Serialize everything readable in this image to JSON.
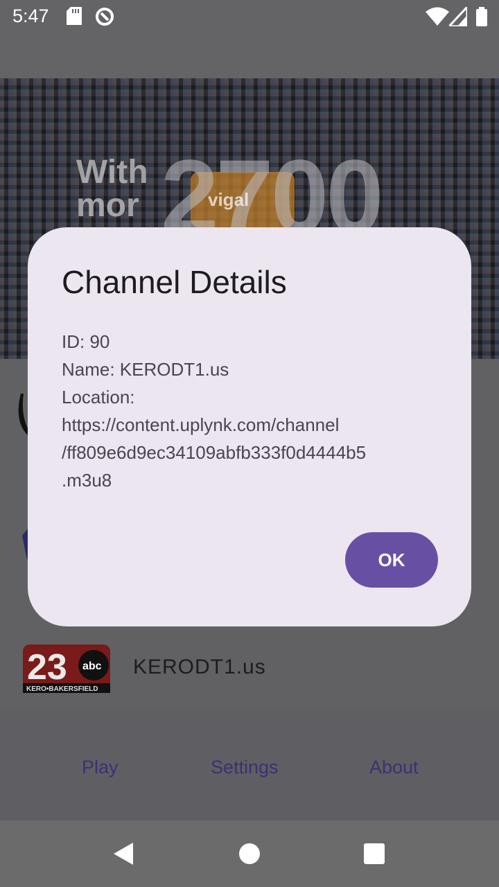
{
  "status_bar": {
    "time": "5:47",
    "icons": [
      "sd-card-icon",
      "sync-icon",
      "wifi-icon",
      "signal-icon",
      "battery-icon"
    ]
  },
  "banner": {
    "text_small_line1": "With",
    "text_small_line2": "mor",
    "text_big": "2700",
    "puzzle_text": "vigal"
  },
  "list": {
    "items": [
      {
        "name": "KERODT1.us",
        "logo_text_number": "23",
        "logo_text_abc": "abc",
        "logo_text_sub": "KERO•BAKERSFIELD"
      }
    ]
  },
  "bottom_nav": {
    "play": "Play",
    "settings": "Settings",
    "about": "About"
  },
  "dialog": {
    "title": "Channel Details",
    "id_line": "ID: 90",
    "name_line": "Name: KERODT1.us",
    "location_line1": "Location:",
    "location_line2": "https://content.uplynk.com/channel",
    "location_line3": "/ff809e6d9ec34109abfb333f0d4444b5",
    "location_line4": ".m3u8",
    "ok_label": "OK"
  },
  "colors": {
    "dialog_bg": "#ece6f0",
    "accent": "#6750a4",
    "scrim_bg": "#646466"
  }
}
